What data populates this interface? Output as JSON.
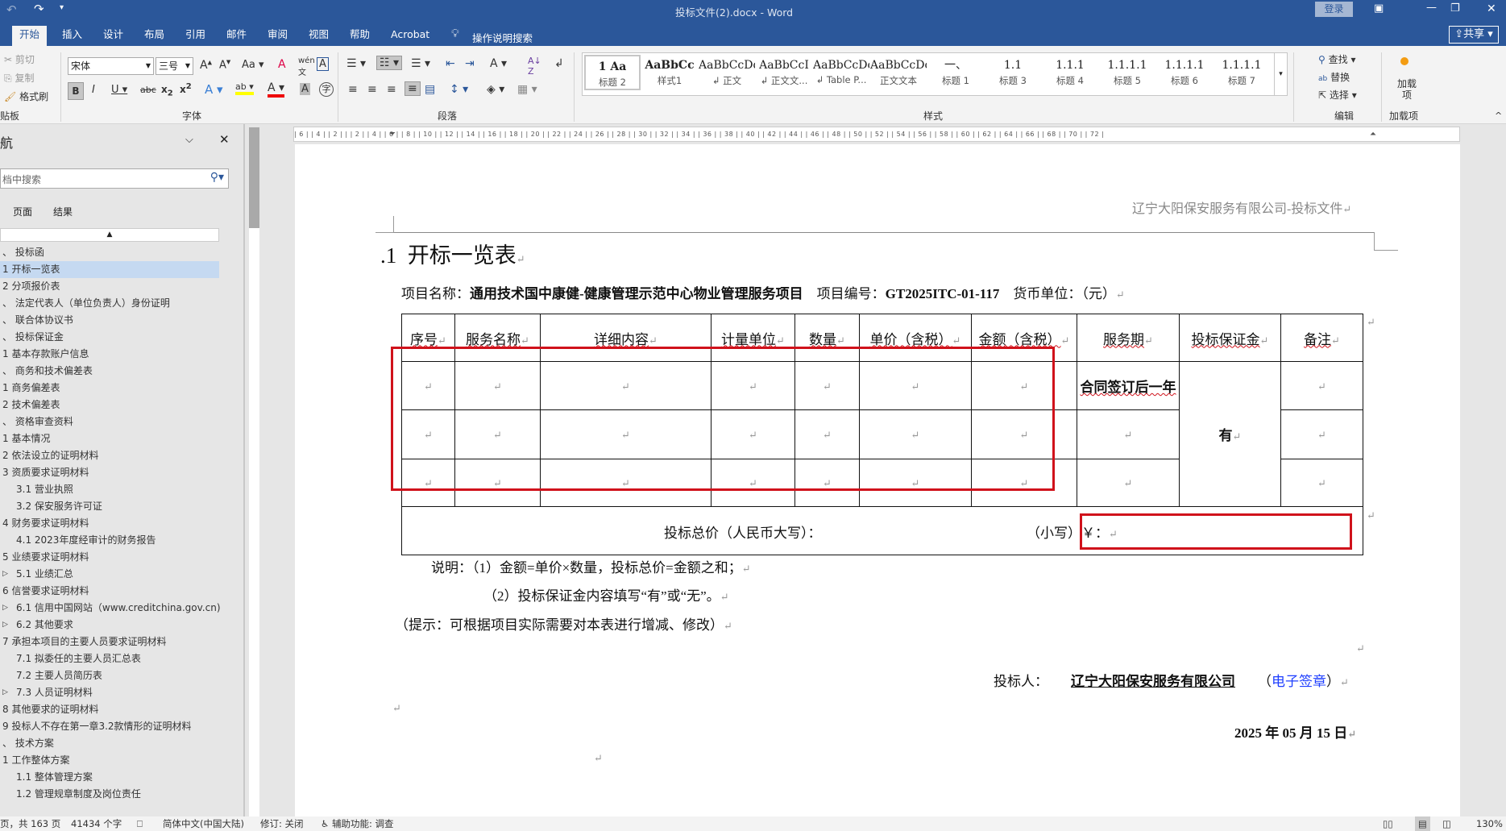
{
  "titlebar": {
    "title": "投标文件(2).docx  -  Word",
    "login": "登录",
    "share": "共享"
  },
  "tabs": [
    "开始",
    "插入",
    "设计",
    "布局",
    "引用",
    "邮件",
    "审阅",
    "视图",
    "帮助",
    "Acrobat"
  ],
  "tell_me": "操作说明搜索",
  "ribbon": {
    "clipboard": {
      "cut": "剪切",
      "copy": "复制",
      "format_painter": "格式刷",
      "label": "贴板"
    },
    "font": {
      "name": "宋体",
      "size": "三号",
      "label": "字体"
    },
    "paragraph": {
      "label": "段落"
    },
    "styles": {
      "label": "样式",
      "items": [
        {
          "preview": "1  Aa",
          "name": "标题 2"
        },
        {
          "preview": "AaBbCc",
          "name": "样式1"
        },
        {
          "preview": "AaBbCcDdI",
          "name": "↲ 正文"
        },
        {
          "preview": "AaBbCcI",
          "name": "↲ 正文文..."
        },
        {
          "preview": "AaBbCcDc",
          "name": "↲ Table P..."
        },
        {
          "preview": "AaBbCcDc",
          "name": "正文文本"
        },
        {
          "preview": "一、",
          "name": "标题 1"
        },
        {
          "preview": "1.1",
          "name": "标题 3"
        },
        {
          "preview": "1.1.1",
          "name": "标题 4"
        },
        {
          "preview": "1.1.1.1",
          "name": "标题 5"
        },
        {
          "preview": "1.1.1.1",
          "name": "标题 6"
        },
        {
          "preview": "1.1.1.1",
          "name": "标题 7"
        }
      ]
    },
    "editing": {
      "find": "查找",
      "replace": "替换",
      "select": "选择",
      "label": "编辑"
    },
    "addins": {
      "button": "加载项",
      "label": "加载项"
    }
  },
  "nav": {
    "title": "航",
    "search_placeholder": "档中搜索",
    "tabs": [
      "页面",
      "结果"
    ],
    "items": [
      {
        "text": "、 投标函",
        "indent": 0
      },
      {
        "text": "1 开标一览表",
        "indent": 0,
        "selected": true
      },
      {
        "text": "2 分项报价表",
        "indent": 0
      },
      {
        "text": "、 法定代表人（单位负责人）身份证明",
        "indent": 0
      },
      {
        "text": "、 联合体协议书",
        "indent": 0
      },
      {
        "text": "、 投标保证金",
        "indent": 0
      },
      {
        "text": "1 基本存款账户信息",
        "indent": 0
      },
      {
        "text": "、 商务和技术偏差表",
        "indent": 0
      },
      {
        "text": "1 商务偏差表",
        "indent": 0
      },
      {
        "text": "2 技术偏差表",
        "indent": 0
      },
      {
        "text": "、 资格审查资料",
        "indent": 0
      },
      {
        "text": "1 基本情况",
        "indent": 0
      },
      {
        "text": "2 依法设立的证明材料",
        "indent": 0
      },
      {
        "text": "3 资质要求证明材料",
        "indent": 0
      },
      {
        "text": "3.1 营业执照",
        "indent": 1
      },
      {
        "text": "3.2 保安服务许可证",
        "indent": 1
      },
      {
        "text": "4 财务要求证明材料",
        "indent": 0
      },
      {
        "text": "4.1 2023年度经审计的财务报告",
        "indent": 1
      },
      {
        "text": "5 业绩要求证明材料",
        "indent": 0
      },
      {
        "text": "5.1 业绩汇总",
        "indent": 1,
        "expand": true
      },
      {
        "text": "6 信誉要求证明材料",
        "indent": 0
      },
      {
        "text": "6.1 信用中国网站（www.creditchina.gov.cn)",
        "indent": 1,
        "expand": true
      },
      {
        "text": "6.2 其他要求",
        "indent": 1,
        "expand": true
      },
      {
        "text": "7 承担本项目的主要人员要求证明材料",
        "indent": 0
      },
      {
        "text": "7.1 拟委任的主要人员汇总表",
        "indent": 1
      },
      {
        "text": "7.2 主要人员简历表",
        "indent": 1
      },
      {
        "text": "7.3 人员证明材料",
        "indent": 1,
        "expand": true
      },
      {
        "text": "8 其他要求的证明材料",
        "indent": 0
      },
      {
        "text": "9 投标人不存在第一章3.2款情形的证明材料",
        "indent": 0
      },
      {
        "text": "、 技术方案",
        "indent": 0
      },
      {
        "text": "1 工作整体方案",
        "indent": 0
      },
      {
        "text": "1.1 整体管理方案",
        "indent": 1
      },
      {
        "text": "1.2 管理规章制度及岗位责任",
        "indent": 1
      }
    ]
  },
  "ruler": "| 6 |  | 4 |  | 2 |  |  | 2 |  | 4 |  | 6 |  | 8 |  | 10 |  | 12 |  | 14 |  | 16 |  | 18 |  | 20 |  | 22 |  | 24 |  | 26 |  | 28 |  | 30 |  | 32 |  | 34 |  | 36 |  | 38 |  | 40 |  | 42 |  | 44 |  | 46 |  | 48 |  | 50 |  | 52 |  | 54 |  | 56 |  | 58 |  | 60 |  | 62 |  | 64 |  | 66 |  | 68 |  | 70 |  | 72 |",
  "doc": {
    "header": "辽宁大阳保安服务有限公司-投标文件",
    "heading_num": ".1",
    "heading": "开标一览表",
    "project_label": "项目名称：",
    "project_name": "通用技术国中康健-健康管理示范中心物业管理服务项目",
    "project_no_label": "项目编号：",
    "project_no": "GT2025ITC-01-117",
    "currency": "货币单位：（元）",
    "table": {
      "headers": [
        "序号",
        "服务名称",
        "详细内容",
        "计量单位",
        "数量",
        "单价（含税）",
        "金额（含税）",
        "服务期",
        "投标保证金",
        "备注"
      ],
      "service_period": "合同签订后一年",
      "deposit": "有",
      "total_upper": "投标总价（人民币大写）：",
      "total_lower": "（小写）￥："
    },
    "note1": "说明：（1）金额=单价×数量，投标总价=金额之和；",
    "note2": "（2）投标保证金内容填写“有”或“无”。",
    "hint": "（提示：可根据项目实际需要对本表进行增减、修改）",
    "bidder_label": "投标人：",
    "bidder": "辽宁大阳保安服务有限公司",
    "esign": "电子签章",
    "date": "2025 年 05 月 15 日"
  },
  "status": {
    "page": "页，共 163 页",
    "words": "41434 个字",
    "lang": "简体中文(中国大陆)",
    "track": "修订: 关闭",
    "access": "辅助功能: 调查",
    "zoom": "130%"
  }
}
